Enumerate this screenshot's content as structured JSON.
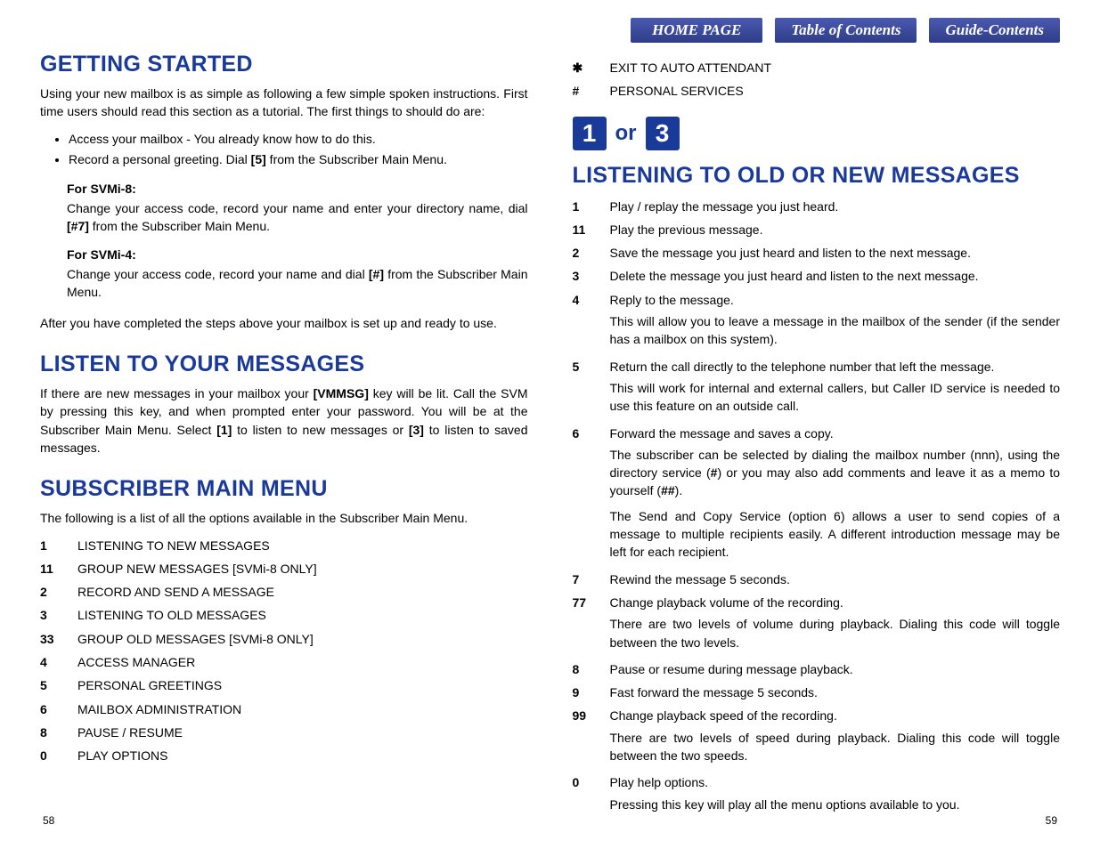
{
  "nav": {
    "home": "HOME PAGE",
    "toc": "Table of Contents",
    "guide": "Guide-Contents"
  },
  "left": {
    "h_getting_started": "GETTING STARTED",
    "p_intro": "Using your new mailbox is as simple as following a few simple spoken instructions. First time users should read this section as a tutorial. The first things to should do are:",
    "bullets": [
      "Access your mailbox - You already know how to do this.",
      "Record a personal greeting. Dial [5] from the Subscriber Main Menu."
    ],
    "svmi8_h": "For SVMi-8:",
    "svmi8_p": "Change your access code, record your name and enter your directory name, dial [#7] from the Subscriber Main Menu.",
    "svmi4_h": "For SVMi-4:",
    "svmi4_p": "Change your access code, record your name and dial [#] from the Subscriber Main Menu.",
    "p_after": "After you have completed the steps above your mailbox is set up and ready to use.",
    "h_listen": "LISTEN TO YOUR MESSAGES",
    "p_listen": "If there are new messages in your mailbox your [VMMSG] key will be lit. Call the SVM by pressing this key, and when prompted enter your password. You will be at the Subscriber Main Menu. Select [1] to listen to new messages or [3] to listen to saved messages.",
    "h_mainmenu": "SUBSCRIBER MAIN MENU",
    "p_mainmenu": "The following is a list of all the options available in the Subscriber Main Menu.",
    "menu": [
      {
        "k": "1",
        "t": "LISTENING TO NEW MESSAGES"
      },
      {
        "k": "11",
        "t": "GROUP NEW MESSAGES [SVMi-8 ONLY]"
      },
      {
        "k": "2",
        "t": "RECORD AND SEND A MESSAGE"
      },
      {
        "k": "3",
        "t": "LISTENING TO OLD MESSAGES"
      },
      {
        "k": "33",
        "t": "GROUP OLD MESSAGES [SVMi-8 ONLY]"
      },
      {
        "k": "4",
        "t": "ACCESS MANAGER"
      },
      {
        "k": "5",
        "t": "PERSONAL GREETINGS"
      },
      {
        "k": "6",
        "t": "MAILBOX ADMINISTRATION"
      },
      {
        "k": "8",
        "t": "PAUSE / RESUME"
      },
      {
        "k": "0",
        "t": "PLAY OPTIONS"
      }
    ],
    "page_num": "58"
  },
  "right": {
    "top_opts": [
      {
        "k": "✱",
        "t": "EXIT TO AUTO ATTENDANT"
      },
      {
        "k": "#",
        "t": "PERSONAL SERVICES"
      }
    ],
    "key1": "1",
    "key_or": "or",
    "key3": "3",
    "h_listening": "LISTENING TO OLD OR NEW MESSAGES",
    "opts": [
      {
        "k": "1",
        "t": "Play / replay the message you just heard."
      },
      {
        "k": "11",
        "t": "Play the previous message."
      },
      {
        "k": "2",
        "t": "Save the message you just heard and listen to the next message."
      },
      {
        "k": "3",
        "t": "Delete the message you just heard and listen to the next message."
      },
      {
        "k": "4",
        "t": "Reply to the message.",
        "n": [
          "This will allow you to leave a message in the mailbox of the sender (if the sender has a mailbox on this system)."
        ]
      },
      {
        "k": "5",
        "t": "Return the call directly to the telephone number that left the message.",
        "n": [
          "This will work for internal and external callers, but Caller ID service is needed to use this feature on an outside call."
        ]
      },
      {
        "k": "6",
        "t": "Forward the message and saves a copy.",
        "n": [
          "The subscriber can be selected by dialing the mailbox number (nnn), using the directory service (#) or you may also add comments and leave it as a memo to yourself (##).",
          "The Send and Copy Service (option 6) allows a user to send copies of a message to multiple recipients easily. A different introduction message may be left for each recipient."
        ]
      },
      {
        "k": "7",
        "t": "Rewind the message 5 seconds."
      },
      {
        "k": "77",
        "t": "Change playback volume of the recording.",
        "n": [
          "There are two levels of volume during playback. Dialing this code will toggle between the two levels."
        ]
      },
      {
        "k": "8",
        "t": "Pause or resume during message playback."
      },
      {
        "k": "9",
        "t": "Fast forward the message 5 seconds."
      },
      {
        "k": "99",
        "t": "Change playback speed of the recording.",
        "n": [
          "There are two levels of speed during playback. Dialing this code will toggle between the two speeds."
        ]
      },
      {
        "k": "0",
        "t": "Play help options.",
        "n": [
          "Pressing this key will play all the menu options available to you."
        ]
      }
    ],
    "page_num": "59"
  }
}
